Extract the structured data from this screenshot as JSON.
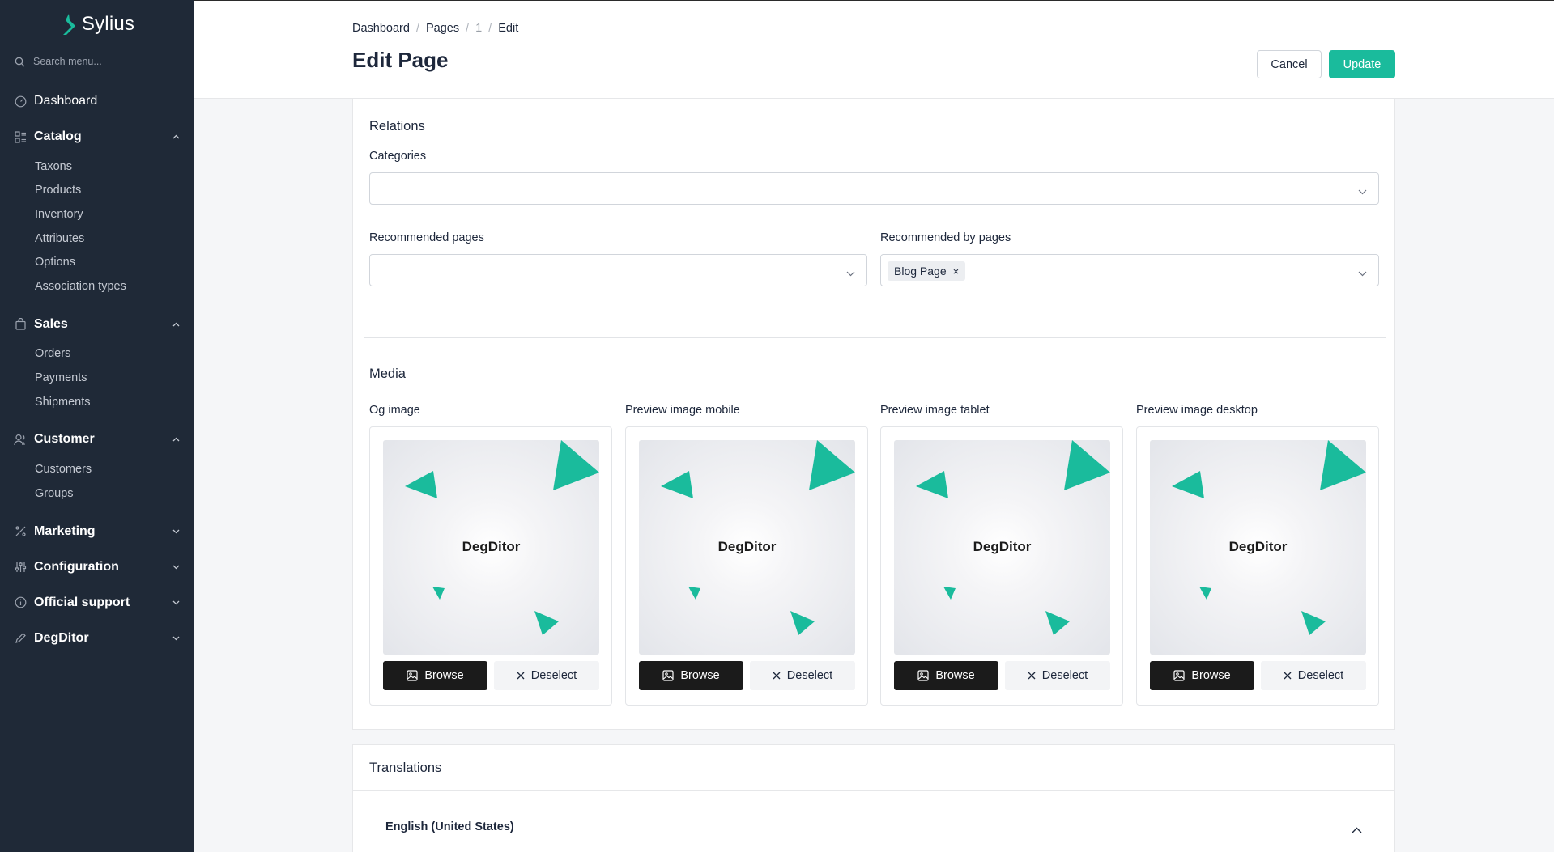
{
  "sidebar": {
    "brand": "Sylius",
    "search_placeholder": "Search menu...",
    "dashboard": "Dashboard",
    "catalog": {
      "label": "Catalog",
      "items": [
        "Taxons",
        "Products",
        "Inventory",
        "Attributes",
        "Options",
        "Association types"
      ]
    },
    "sales": {
      "label": "Sales",
      "items": [
        "Orders",
        "Payments",
        "Shipments"
      ]
    },
    "customer": {
      "label": "Customer",
      "items": [
        "Customers",
        "Groups"
      ]
    },
    "marketing": "Marketing",
    "configuration": "Configuration",
    "support": "Official support",
    "degditor": "DegDitor"
  },
  "header": {
    "breadcrumb": [
      "Dashboard",
      "Pages",
      "1",
      "Edit"
    ],
    "title": "Edit Page",
    "cancel": "Cancel",
    "update": "Update"
  },
  "relations": {
    "title": "Relations",
    "categories_label": "Categories",
    "recommended_label": "Recommended pages",
    "recommended_by_label": "Recommended by pages",
    "recommended_by_tag": "Blog Page",
    "tag_remove": "×"
  },
  "media": {
    "title": "Media",
    "images": [
      {
        "label": "Og image",
        "caption": "DegDitor"
      },
      {
        "label": "Preview image mobile",
        "caption": "DegDitor"
      },
      {
        "label": "Preview image tablet",
        "caption": "DegDitor"
      },
      {
        "label": "Preview image desktop",
        "caption": "DegDitor"
      }
    ],
    "browse": "Browse",
    "deselect": "Deselect"
  },
  "translations": {
    "title": "Translations",
    "locale": "English (United States)"
  },
  "colors": {
    "accent": "#1abb9c",
    "sidebar_bg": "#1f2937",
    "dark_button": "#1b1b1b"
  }
}
